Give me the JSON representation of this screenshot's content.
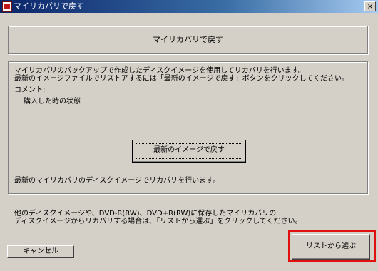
{
  "window": {
    "title": "マイリカバリで戻す",
    "close_glyph": "×"
  },
  "header": {
    "title": "マイリカバリで戻す"
  },
  "main": {
    "description_line1": "マイリカバリのバックアップで作成したディスクイメージを使用してリカバリを行います。",
    "description_line2": "最新のイメージファイルでリストアするには「最新のイメージで戻す」ボタンをクリックしてください。",
    "comment_label": "コメント:",
    "comment_value": "購入した時の状態",
    "latest_button_label": "最新のイメージで戻す",
    "latest_note": "最新のマイリカバリのディスクイメージでリカバリを行います。"
  },
  "footer": {
    "other_line1": "他のディスクイメージや、DVD-R(RW)、DVD+R(RW)に保存したマイリカバリの",
    "other_line2": "ディスクイメージからリカバリする場合は、「リストから選ぶ」をクリックしてください。",
    "cancel_label": "キャンセル",
    "list_button_label": "リストから選ぶ"
  },
  "colors": {
    "background": "#d4d0c8",
    "titlebar": "#0a246a",
    "highlight": "#e01010"
  }
}
